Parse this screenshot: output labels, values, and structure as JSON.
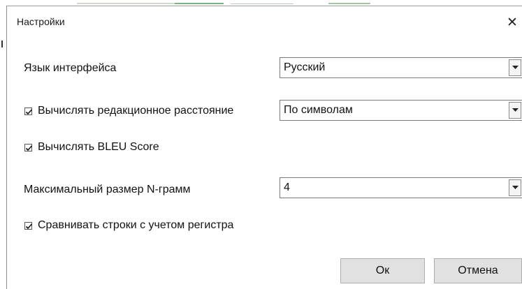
{
  "window": {
    "title": "Настройки",
    "close_glyph": "✕"
  },
  "settings": {
    "language": {
      "label": "Язык интерфейса",
      "selected": "Русский"
    },
    "edit_distance": {
      "label": "Вычислять редакционное расстояние",
      "checked": true,
      "selected": "По символам"
    },
    "bleu": {
      "label": "Вычислять BLEU Score",
      "checked": true
    },
    "ngram": {
      "label": "Максимальный размер N-грамм",
      "selected": "4"
    },
    "case_sensitive": {
      "label": "Сравнивать строки с учетом регистра",
      "checked": true
    }
  },
  "buttons": {
    "ok": "Ок",
    "cancel": "Отмена"
  },
  "icons": {
    "close": "close-icon",
    "dropdown": "chevron-down-icon",
    "check": "checkmark-icon"
  }
}
